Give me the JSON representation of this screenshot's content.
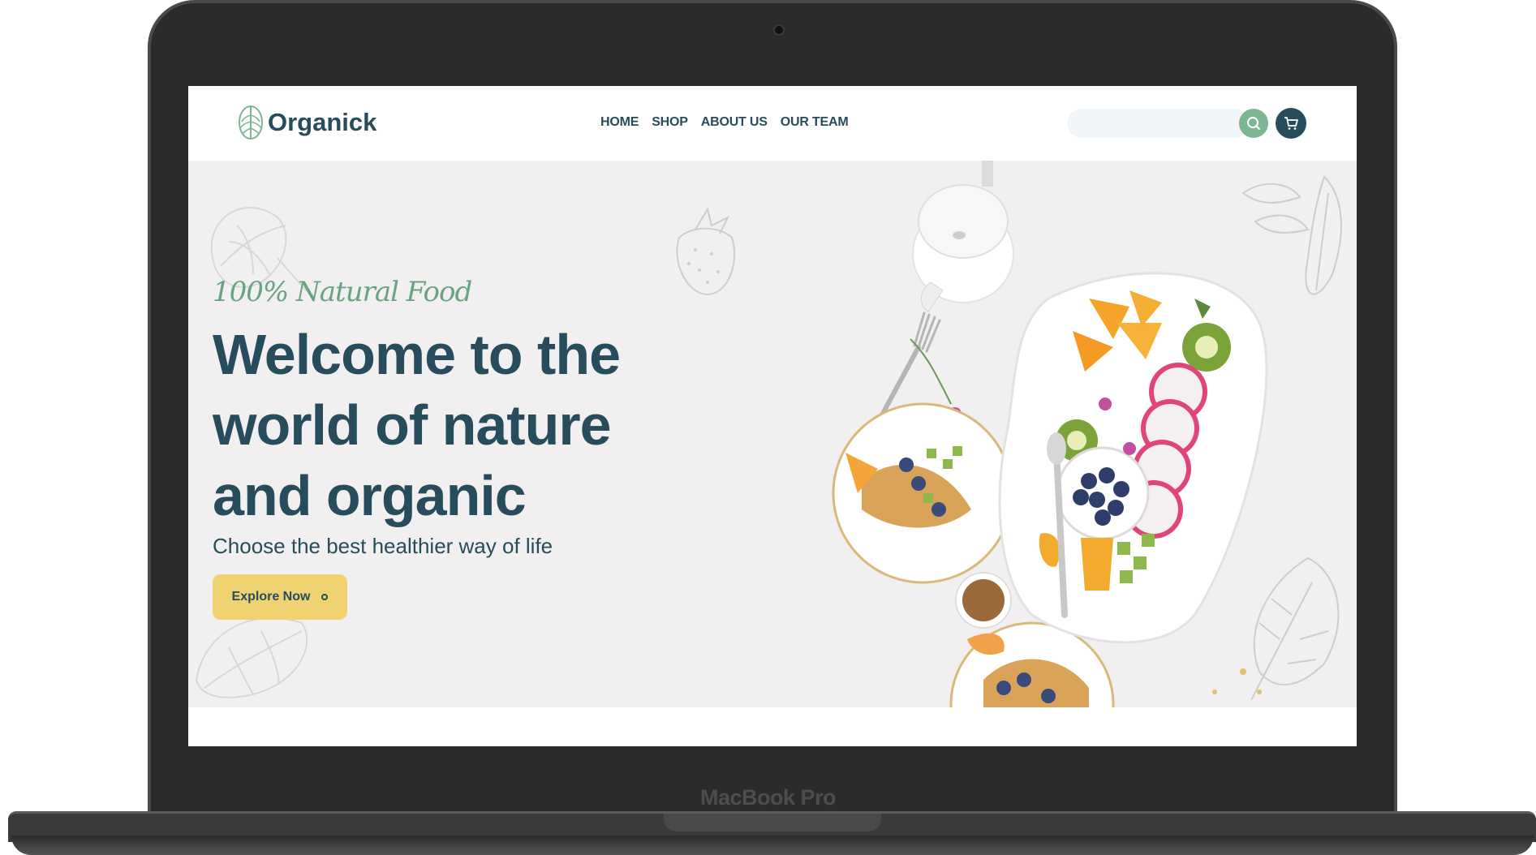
{
  "device": {
    "brand_label": "MacBook Pro"
  },
  "header": {
    "logo_text": "Organick",
    "nav_items": [
      {
        "label": "HOME"
      },
      {
        "label": "SHOP"
      },
      {
        "label": "ABOUT US"
      },
      {
        "label": "OUR TEAM"
      }
    ],
    "search": {
      "value": "",
      "placeholder": ""
    },
    "icons": {
      "search": "search-icon",
      "cart": "cart-icon",
      "logo": "leaf-icon"
    }
  },
  "hero": {
    "tagline": "100% Natural Food",
    "title": "Welcome to the world of nature and organic",
    "subtitle": "Choose the best healthier way of life",
    "cta_label": "Explore Now"
  },
  "colors": {
    "primary": "#274c5b",
    "accent_green": "#7eb693",
    "cta_yellow": "#efd372",
    "hero_bg": "#f1eff0"
  }
}
